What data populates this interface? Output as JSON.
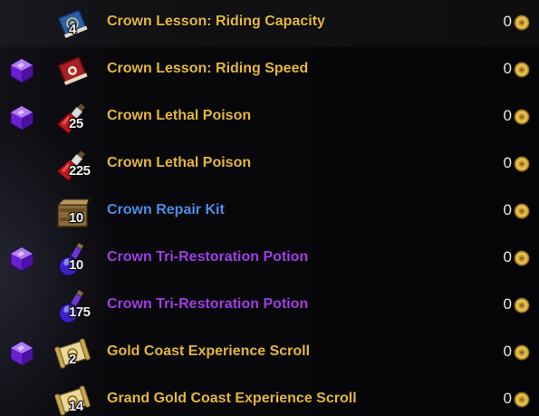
{
  "colors": {
    "gold_quality": "#e5b83b",
    "blue_quality": "#4a8fe8",
    "purple_quality": "#a13ee6",
    "price_text": "#e8e8e8"
  },
  "items": [
    {
      "name": "Crown Lesson: Riding Capacity",
      "stack": "4",
      "price": "0",
      "quality": "gold",
      "crown_gem": false,
      "icon": "blue-book-icon"
    },
    {
      "name": "Crown Lesson: Riding Speed",
      "stack": "",
      "price": "0",
      "quality": "gold",
      "crown_gem": true,
      "icon": "red-book-icon"
    },
    {
      "name": "Crown Lethal Poison",
      "stack": "25",
      "price": "0",
      "quality": "gold",
      "crown_gem": true,
      "icon": "poison-vial-icon"
    },
    {
      "name": "Crown Lethal Poison",
      "stack": "225",
      "price": "0",
      "quality": "gold",
      "crown_gem": false,
      "icon": "poison-vial-icon"
    },
    {
      "name": "Crown Repair Kit",
      "stack": "10",
      "price": "0",
      "quality": "blue",
      "crown_gem": false,
      "icon": "repair-kit-icon"
    },
    {
      "name": "Crown Tri-Restoration Potion",
      "stack": "10",
      "price": "0",
      "quality": "purple",
      "crown_gem": true,
      "icon": "potion-flask-icon"
    },
    {
      "name": "Crown Tri-Restoration Potion",
      "stack": "175",
      "price": "0",
      "quality": "purple",
      "crown_gem": false,
      "icon": "potion-flask-icon"
    },
    {
      "name": "Gold Coast Experience Scroll",
      "stack": "2",
      "price": "0",
      "quality": "gold",
      "crown_gem": true,
      "icon": "scroll-icon"
    },
    {
      "name": "Grand Gold Coast Experience Scroll",
      "stack": "14",
      "price": "0",
      "quality": "gold",
      "crown_gem": false,
      "icon": "scroll-icon"
    }
  ]
}
